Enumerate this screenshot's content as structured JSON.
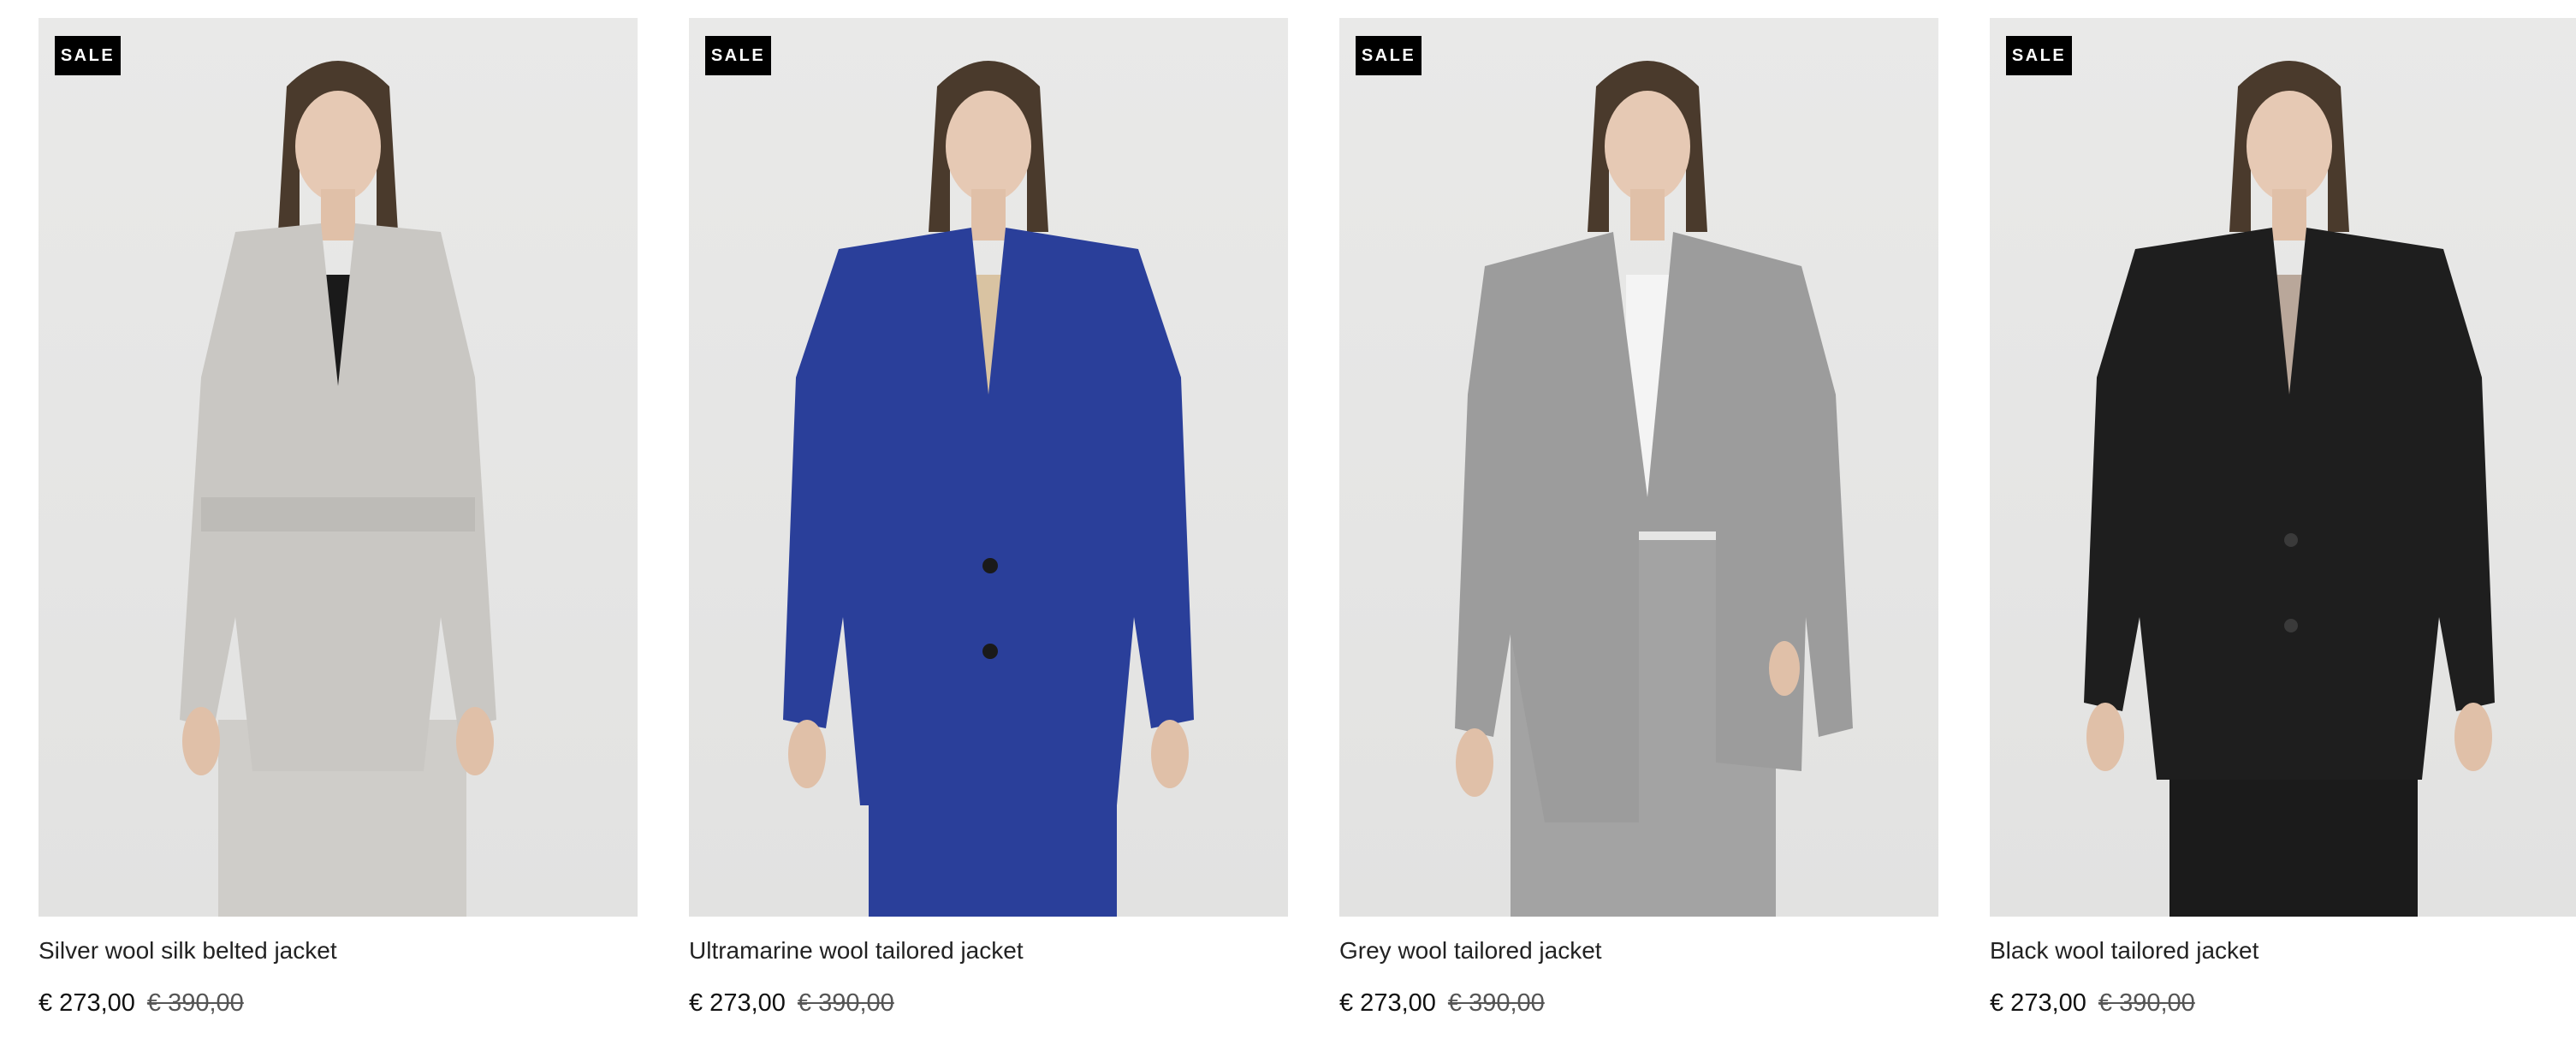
{
  "products": [
    {
      "badge": "SALE",
      "title": "Silver wool silk belted jacket",
      "price": "€ 273,00",
      "original_price": "€ 390,00",
      "colors": {
        "jacket": "#c9c7c3",
        "inner": "#1a1a1a",
        "trousers": "#cfcdc9"
      }
    },
    {
      "badge": "SALE",
      "title": "Ultramarine wool tailored jacket",
      "price": "€ 273,00",
      "original_price": "€ 390,00",
      "colors": {
        "jacket": "#2a3f9a",
        "inner": "#d9c3a2",
        "trousers": "#2a3f9a"
      }
    },
    {
      "badge": "SALE",
      "title": "Grey wool tailored jacket",
      "price": "€ 273,00",
      "original_price": "€ 390,00",
      "colors": {
        "jacket": "#9c9c9c",
        "inner": "#f4f4f4",
        "trousers": "#a3a3a3"
      }
    },
    {
      "badge": "SALE",
      "title": "Black wool tailored jacket",
      "price": "€ 273,00",
      "original_price": "€ 390,00",
      "colors": {
        "jacket": "#1e1e1e",
        "inner": "#b9a79a",
        "trousers": "#1b1b1b"
      }
    }
  ]
}
